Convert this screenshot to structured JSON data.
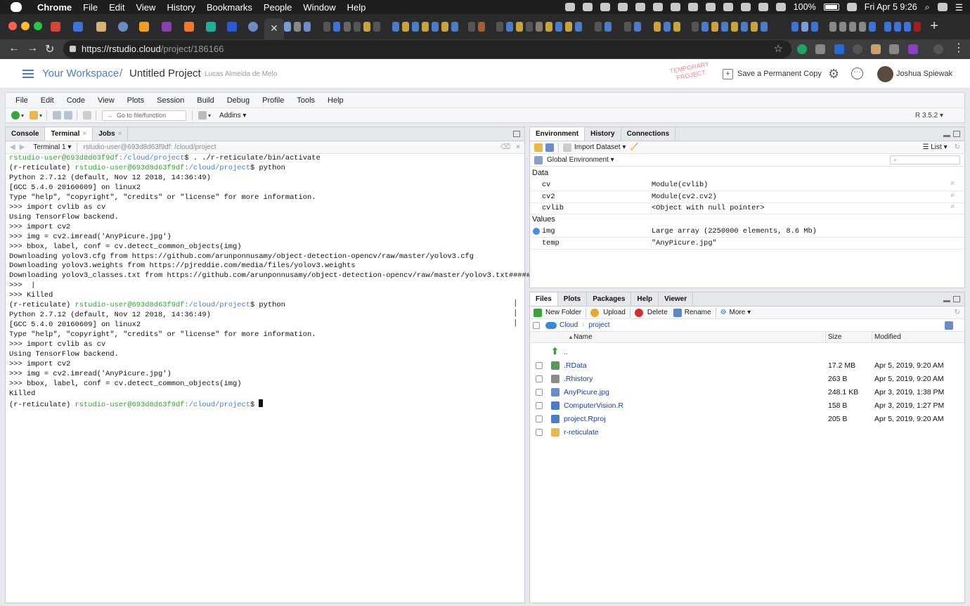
{
  "mac_menubar": {
    "app": "Chrome",
    "items": [
      "File",
      "Edit",
      "View",
      "History",
      "Bookmarks",
      "People",
      "Window",
      "Help"
    ],
    "battery": "100%",
    "datetime": "Fri Apr 5  9:26"
  },
  "browser": {
    "url_host": "https://rstudio.cloud",
    "url_path": "/project/186166",
    "new_tab_label": "+"
  },
  "cloud_header": {
    "workspace": "Your Workspace",
    "slash": "/",
    "project": "Untitled Project",
    "owner": "Lucas Almeida de Melo",
    "temp_badge": "TEMPORARY PROJECT",
    "save_copy": "Save a Permanent Copy",
    "user": "Joshua Spiewak"
  },
  "ide": {
    "menu": [
      "File",
      "Edit",
      "Code",
      "View",
      "Plots",
      "Session",
      "Build",
      "Debug",
      "Profile",
      "Tools",
      "Help"
    ],
    "goto_placeholder": "Go to file/function",
    "addins": "Addins",
    "r_version": "R 3.5.2"
  },
  "left_pane": {
    "tabs": [
      "Console",
      "Terminal",
      "Jobs"
    ],
    "active_tab": "Terminal",
    "terminal_select": "Terminal 1",
    "terminal_title": "rstudio-user@693d8d63f9df: /cloud/project",
    "lines": [
      {
        "user": "rstudio-user@693d8d63f9df",
        "path": ":/cloud/project",
        "cmd": "$ . ./r-reticulate/bin/activate"
      },
      {
        "pre": "(r-reticulate) ",
        "user": "rstudio-user@693d8d63f9df",
        "path": ":/cloud/project",
        "cmd": "$ python"
      },
      {
        "text": "Python 2.7.12 (default, Nov 12 2018, 14:36:49)"
      },
      {
        "text": "[GCC 5.4.0 20160609] on linux2"
      },
      {
        "text": "Type \"help\", \"copyright\", \"credits\" or \"license\" for more information."
      },
      {
        "text": ">>> import cvlib as cv"
      },
      {
        "text": "Using TensorFlow backend."
      },
      {
        "text": ">>> import cv2"
      },
      {
        "text": ">>> img = cv2.imread('AnyPicure.jpg')"
      },
      {
        "text": ">>> bbox, label, conf = cv.detect_common_objects(img)"
      },
      {
        "text": "Downloading yolov3.cfg from https://github.com/arunponnusamy/object-detection-opencv/raw/master/yolov3.cfg"
      },
      {
        "text": "Downloading yolov3.weights from https://pjreddie.com/media/files/yolov3.weights"
      },
      {
        "text": "Downloading yolov3_classes.txt from https://github.com/arunponnusamy/object-detection-opencv/raw/master/yolov3.txt#####"
      },
      {
        "text": ">>>  |"
      },
      {
        "text": ">>> Killed"
      },
      {
        "pre": "(r-reticulate) ",
        "user": "rstudio-user@693d8d63f9df",
        "path": ":/cloud/project",
        "cmd": "$ python"
      },
      {
        "text": "Python 2.7.12 (default, Nov 12 2018, 14:36:49)"
      },
      {
        "text": "[GCC 5.4.0 20160609] on linux2"
      },
      {
        "text": "Type \"help\", \"copyright\", \"credits\" or \"license\" for more information."
      },
      {
        "text": ">>> import cvlib as cv"
      },
      {
        "text": "Using TensorFlow backend."
      },
      {
        "text": ">>> import cv2"
      },
      {
        "text": ">>> img = cv2.imread('AnyPicure.jpg')"
      },
      {
        "text": ">>> bbox, label, conf = cv.detect_common_objects(img)"
      },
      {
        "text": "Killed"
      },
      {
        "pre": "(r-reticulate) ",
        "user": "rstudio-user@693d8d63f9df",
        "path": ":/cloud/project",
        "cmd": "$ ",
        "cursor": true
      }
    ],
    "scroll_marks": [
      "|",
      "|",
      "|"
    ]
  },
  "env_pane": {
    "tabs": [
      "Environment",
      "History",
      "Connections"
    ],
    "import_dataset": "Import Dataset",
    "list_view": "List",
    "global_env": "Global Environment",
    "data_header": "Data",
    "values_header": "Values",
    "data": [
      {
        "name": "cv",
        "value": "Module(cvlib)"
      },
      {
        "name": "cv2",
        "value": "Module(cv2.cv2)"
      },
      {
        "name": "cvlib",
        "value": "<Object with null pointer>"
      }
    ],
    "values": [
      {
        "name": "img",
        "value": "Large array (2250000 elements, 8.6 Mb)"
      },
      {
        "name": "temp",
        "value": "\"AnyPicure.jpg\""
      }
    ]
  },
  "files_pane": {
    "tabs": [
      "Files",
      "Plots",
      "Packages",
      "Help",
      "Viewer"
    ],
    "actions": [
      "New Folder",
      "Upload",
      "Delete",
      "Rename",
      "More"
    ],
    "breadcrumb": [
      "Cloud",
      "project"
    ],
    "columns": [
      "Name",
      "Size",
      "Modified"
    ],
    "parent": "..",
    "files": [
      {
        "name": ".RData",
        "size": "17.2 MB",
        "modified": "Apr 5, 2019, 9:20 AM",
        "icon_color": "#5a9a5a"
      },
      {
        "name": ".Rhistory",
        "size": "263 B",
        "modified": "Apr 5, 2019, 9:20 AM",
        "icon_color": "#8a8a8a"
      },
      {
        "name": "AnyPicure.jpg",
        "size": "248.1 KB",
        "modified": "Apr 3, 2019, 1:38 PM",
        "icon_color": "#6b8cc7"
      },
      {
        "name": "ComputerVision.R",
        "size": "158 B",
        "modified": "Apr 3, 2019, 1:27 PM",
        "icon_color": "#4a7cc7"
      },
      {
        "name": "project.Rproj",
        "size": "205 B",
        "modified": "Apr 5, 2019, 9:20 AM",
        "icon_color": "#4a7cc7"
      },
      {
        "name": "r-reticulate",
        "size": "",
        "modified": "",
        "icon_color": "#e8b84a"
      }
    ]
  }
}
